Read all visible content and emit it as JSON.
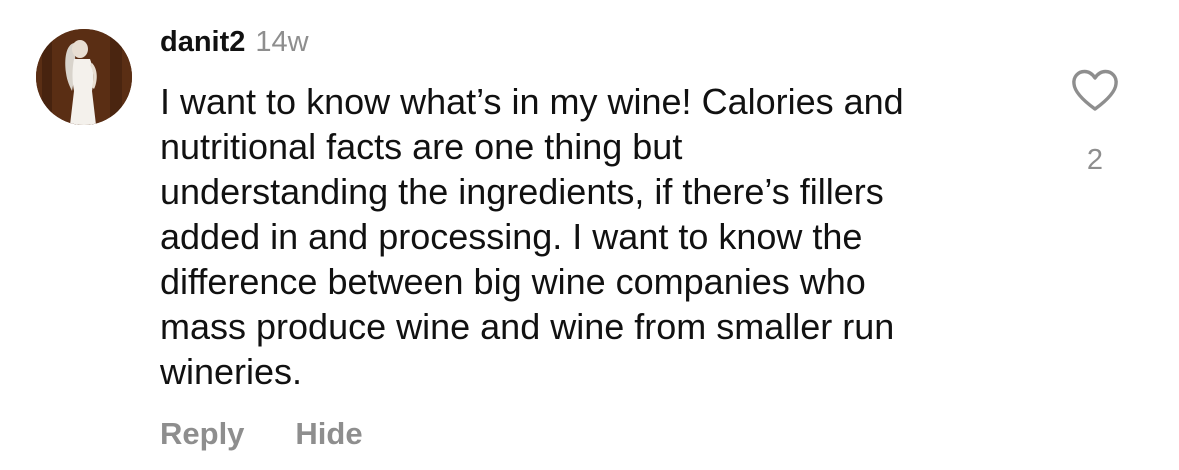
{
  "comment": {
    "username": "danit2",
    "time": "14w",
    "text": "I want to know what’s in my wine! Calories and\nnutritional facts are one thing but\nunderstanding the ingredients, if there’s fillers\nadded in and processing. I want to know the\ndifference between big wine companies who\nmass produce wine and wine from smaller run\nwineries.",
    "actions": {
      "reply_label": "Reply",
      "hide_label": "Hide"
    },
    "likes": {
      "count": "2",
      "icon": "heart-outline-icon"
    }
  },
  "colors": {
    "text": "#111111",
    "secondary": "#8e8e8e",
    "background": "#ffffff"
  }
}
